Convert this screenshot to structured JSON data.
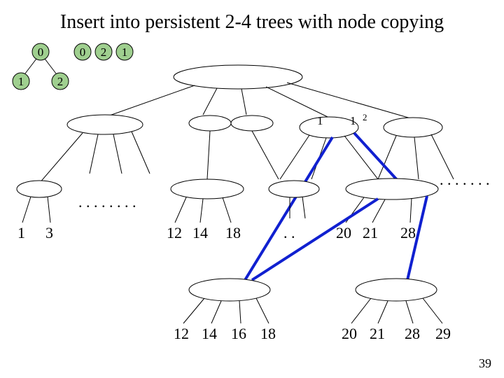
{
  "title": "Insert into persistent 2-4 trees with node copying",
  "page_number": "39",
  "top_circles": {
    "c0a": "0",
    "c0b": "0",
    "c2": "2",
    "c1": "1",
    "c1l": "1",
    "c2r": "2"
  },
  "mid_labels": {
    "one": "1",
    "one_r": "1",
    "two_r": "2"
  },
  "ellipsis_left": ". . . . . . . .",
  "ellipsis_right": ". . . . . . .",
  "row_mid": {
    "a1": "1",
    "a3": "3",
    "b12": "12",
    "b14": "14",
    "b18": "18",
    "dots": ". .",
    "c20": "20",
    "c21": "21",
    "c28": "28"
  },
  "row_bot": {
    "d12": "12",
    "d14": "14",
    "d16": "16",
    "d18": "18",
    "e20": "20",
    "e21": "21",
    "e28": "28",
    "e29": "29"
  },
  "chart_data": {
    "type": "tree-diagram",
    "description": "Persistent 2-4 tree, node-copying illustration",
    "version_markers": [
      0,
      0,
      2,
      1,
      1,
      2
    ],
    "internal_split_labels": [
      1,
      1,
      2
    ],
    "leaf_groups": [
      {
        "name": "far-left",
        "values": [
          1,
          3
        ]
      },
      {
        "name": "middle-upper",
        "values": [
          12,
          14,
          18,
          20,
          21,
          28
        ]
      },
      {
        "name": "bottom-left",
        "values": [
          12,
          14,
          16,
          18
        ]
      },
      {
        "name": "bottom-right",
        "values": [
          20,
          21,
          28,
          29
        ]
      }
    ]
  }
}
